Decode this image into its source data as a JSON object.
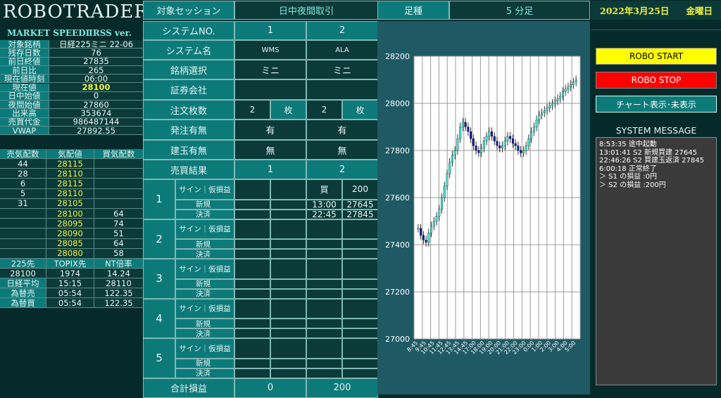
{
  "brand": {
    "title": "ROBOTRADER",
    "subtitle": "MARKET SPEEDⅡRSS ver."
  },
  "info_rows": [
    {
      "label": "対象銘柄",
      "value": "日経225ミニ 22-06"
    },
    {
      "label": "残存日数",
      "value": "76"
    },
    {
      "label": "前日終値",
      "value": "27835"
    },
    {
      "label": "前日比",
      "value": "265"
    },
    {
      "label": "現在値時刻",
      "value": "06:00"
    },
    {
      "label": "現在値",
      "value": "28100"
    },
    {
      "label": "日中始値",
      "value": "0"
    },
    {
      "label": "夜間始値",
      "value": "27860"
    },
    {
      "label": "出来高",
      "value": "353674"
    },
    {
      "label": "売買代金",
      "value": "986487144"
    },
    {
      "label": "VWAP",
      "value": "27892.55"
    }
  ],
  "board": {
    "headers": [
      "売気配数",
      "気配値",
      "買気配数"
    ],
    "rows": [
      [
        "44",
        "28115",
        ""
      ],
      [
        "28",
        "28110",
        ""
      ],
      [
        "6",
        "28115",
        ""
      ],
      [
        "5",
        "28110",
        ""
      ],
      [
        "31",
        "28105",
        ""
      ],
      [
        "",
        "28100",
        "64"
      ],
      [
        "",
        "28095",
        "74"
      ],
      [
        "",
        "28090",
        "51"
      ],
      [
        "",
        "28085",
        "64"
      ],
      [
        "",
        "28080",
        "58"
      ]
    ]
  },
  "index": {
    "headers": [
      "225先",
      "TOPIX先",
      "NT倍率"
    ],
    "row1": [
      "28100",
      "1974",
      "14.24"
    ],
    "rows": [
      {
        "label": "日経平均",
        "time": "15:15",
        "value": "28110"
      },
      {
        "label": "為替売",
        "time": "05:54",
        "value": "122.35"
      },
      {
        "label": "為替買",
        "time": "05:54",
        "value": "122.35"
      }
    ]
  },
  "session": {
    "label": "対象セッション",
    "value": "日中夜間取引"
  },
  "ashi": {
    "label": "足種",
    "value": "5 分足"
  },
  "date": {
    "date": "2022年3月25日",
    "weekday": "金曜日"
  },
  "system_table": {
    "system_no": {
      "label": "システムNO.",
      "s1": "1",
      "s2": "2"
    },
    "system_name": {
      "label": "システム名",
      "s1": "WMS",
      "s2": "ALA"
    },
    "meigara": {
      "label": "銘柄選択",
      "s1": "ミニ",
      "s2": "ミニ"
    },
    "broker": {
      "label": "証券会社",
      "s1": "",
      "s2": ""
    },
    "qty": {
      "label": "注文枚数",
      "s1": "2",
      "s2": "2",
      "unit": "枚"
    },
    "order": {
      "label": "発注有無",
      "s1": "有",
      "s2": "有"
    },
    "position": {
      "label": "建玉有無",
      "s1": "無",
      "s2": "無"
    },
    "result": {
      "label": "売買結果",
      "s1": "1",
      "s2": "2"
    }
  },
  "trades": [
    {
      "no": "1",
      "sign_label": "サイン｜仮損益",
      "new_label": "新規",
      "settle_label": "決済",
      "s1": {
        "sign": "",
        "pnl": "",
        "new_t": "",
        "new_p": "",
        "set_t": "",
        "set_p": ""
      },
      "s2": {
        "sign": "買",
        "pnl": "200",
        "new_t": "13:00",
        "new_p": "27645",
        "set_t": "22:45",
        "set_p": "27845"
      }
    },
    {
      "no": "2",
      "sign_label": "サイン｜仮損益",
      "new_label": "新規",
      "settle_label": "決済",
      "s1": {
        "sign": "",
        "pnl": "",
        "new_t": "",
        "new_p": "",
        "set_t": "",
        "set_p": ""
      },
      "s2": {
        "sign": "",
        "pnl": "",
        "new_t": "",
        "new_p": "",
        "set_t": "",
        "set_p": ""
      }
    },
    {
      "no": "3",
      "sign_label": "サイン｜仮損益",
      "new_label": "新規",
      "settle_label": "決済",
      "s1": {
        "sign": "",
        "pnl": "",
        "new_t": "",
        "new_p": "",
        "set_t": "",
        "set_p": ""
      },
      "s2": {
        "sign": "",
        "pnl": "",
        "new_t": "",
        "new_p": "",
        "set_t": "",
        "set_p": ""
      }
    },
    {
      "no": "4",
      "sign_label": "サイン｜仮損益",
      "new_label": "新規",
      "settle_label": "決済",
      "s1": {
        "sign": "",
        "pnl": "",
        "new_t": "",
        "new_p": "",
        "set_t": "",
        "set_p": ""
      },
      "s2": {
        "sign": "",
        "pnl": "",
        "new_t": "",
        "new_p": "",
        "set_t": "",
        "set_p": ""
      }
    },
    {
      "no": "5",
      "sign_label": "サイン｜仮損益",
      "new_label": "新規",
      "settle_label": "決済",
      "s1": {
        "sign": "",
        "pnl": "",
        "new_t": "",
        "new_p": "",
        "set_t": "",
        "set_p": ""
      },
      "s2": {
        "sign": "",
        "pnl": "",
        "new_t": "",
        "new_p": "",
        "set_t": "",
        "set_p": ""
      }
    }
  ],
  "total": {
    "label": "合計損益",
    "s1": "0",
    "s2": "200"
  },
  "buttons": {
    "start": "ROBO START",
    "stop": "ROBO STOP",
    "chart_toggle": "チャート表示･未表示"
  },
  "messages": {
    "title": "SYSTEM MESSAGE",
    "lines": [
      "8:53:35 途中起動",
      "13:01:41 S2 新規買建 27645",
      "22:46:26 S2 買建玉返済 27845",
      "6:00:18 正常終了",
      "＞ S1 の損益 :0円",
      "＞ S2 の損益 :200円"
    ]
  },
  "colors": {
    "bg": "#062a2a",
    "teal": "#0d7a7a",
    "yellow_text": "#f3f33a",
    "start_btn": "#ffff00",
    "stop_btn": "#ff0000",
    "candle_up": "#40e0d0",
    "candle_down": "#1a1aa0"
  },
  "chart_data": {
    "type": "candlestick",
    "ylim": [
      27000,
      28200
    ],
    "y_ticks": [
      27000,
      27200,
      27400,
      27600,
      27800,
      28000,
      28200
    ],
    "x_tick_labels": [
      "8:45",
      "9:45",
      "10:45",
      "11:45",
      "12:45",
      "13:45",
      "14:45",
      "17:00",
      "18:00",
      "19:00",
      "20:00",
      "21:00",
      "22:00",
      "23:00",
      "0:00",
      "1:00",
      "2:00",
      "3:00",
      "4:00",
      "5:00"
    ],
    "series_close": [
      27470,
      27440,
      27420,
      27410,
      27450,
      27480,
      27500,
      27520,
      27550,
      27600,
      27650,
      27700,
      27750,
      27780,
      27800,
      27850,
      27900,
      27920,
      27900,
      27880,
      27850,
      27820,
      27800,
      27790,
      27810,
      27840,
      27860,
      27880,
      27860,
      27840,
      27820,
      27810,
      27820,
      27840,
      27860,
      27850,
      27830,
      27820,
      27800,
      27790,
      27800,
      27820,
      27850,
      27880,
      27900,
      27930,
      27950,
      27960,
      27970,
      27980,
      27990,
      28000,
      28010,
      28020,
      28030,
      28050,
      28060,
      28070,
      28080,
      28090,
      28100
    ]
  }
}
